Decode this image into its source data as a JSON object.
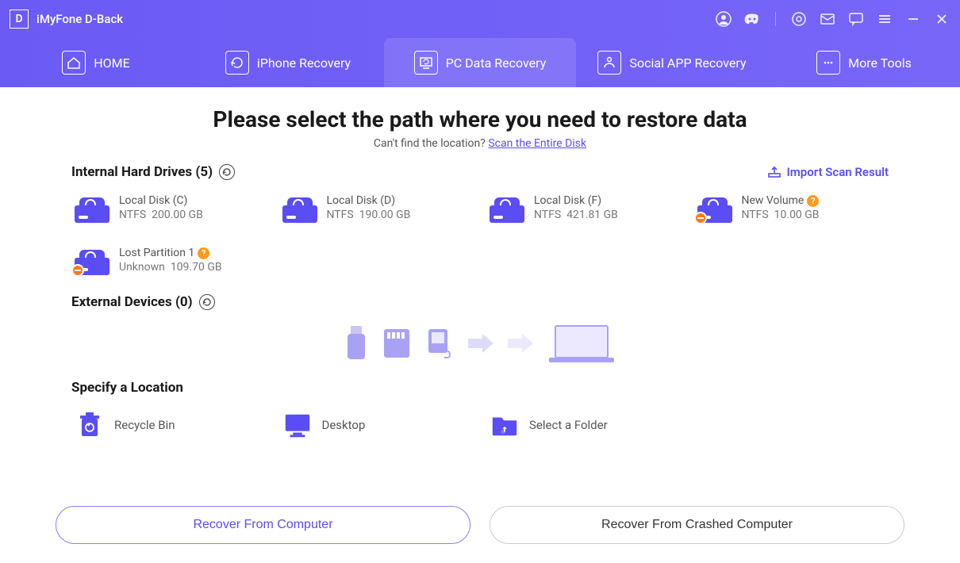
{
  "titlebar": {
    "app_name": "iMyFone D-Back",
    "logo_letter": "D"
  },
  "nav": {
    "home": "HOME",
    "iphone": "iPhone Recovery",
    "pc": "PC Data Recovery",
    "social": "Social APP Recovery",
    "tools": "More Tools"
  },
  "page": {
    "title": "Please select the path where you need to restore data",
    "subtitle_prefix": "Can't find the location? ",
    "subtitle_link": "Scan the Entire Disk"
  },
  "internal": {
    "label": "Internal Hard Drives (5)",
    "import_label": "Import Scan Result",
    "drives": [
      {
        "name": "Local Disk (C)",
        "fs": "NTFS",
        "size": "200.00 GB",
        "warn": false,
        "q": false
      },
      {
        "name": "Local Disk (D)",
        "fs": "NTFS",
        "size": "190.00 GB",
        "warn": false,
        "q": false
      },
      {
        "name": "Local Disk (F)",
        "fs": "NTFS",
        "size": "421.81 GB",
        "warn": false,
        "q": false
      },
      {
        "name": "New Volume",
        "fs": "NTFS",
        "size": "10.00 GB",
        "warn": true,
        "q": true
      },
      {
        "name": "Lost Partition 1",
        "fs": "Unknown",
        "size": "109.70 GB",
        "warn": true,
        "q": true
      }
    ]
  },
  "external": {
    "label": "External Devices (0)"
  },
  "specify": {
    "label": "Specify a Location",
    "items": [
      {
        "name": "Recycle Bin",
        "icon": "recycle"
      },
      {
        "name": "Desktop",
        "icon": "desktop"
      },
      {
        "name": "Select a Folder",
        "icon": "folder"
      }
    ]
  },
  "footer": {
    "recover_computer": "Recover From Computer",
    "recover_crashed": "Recover From Crashed Computer"
  }
}
